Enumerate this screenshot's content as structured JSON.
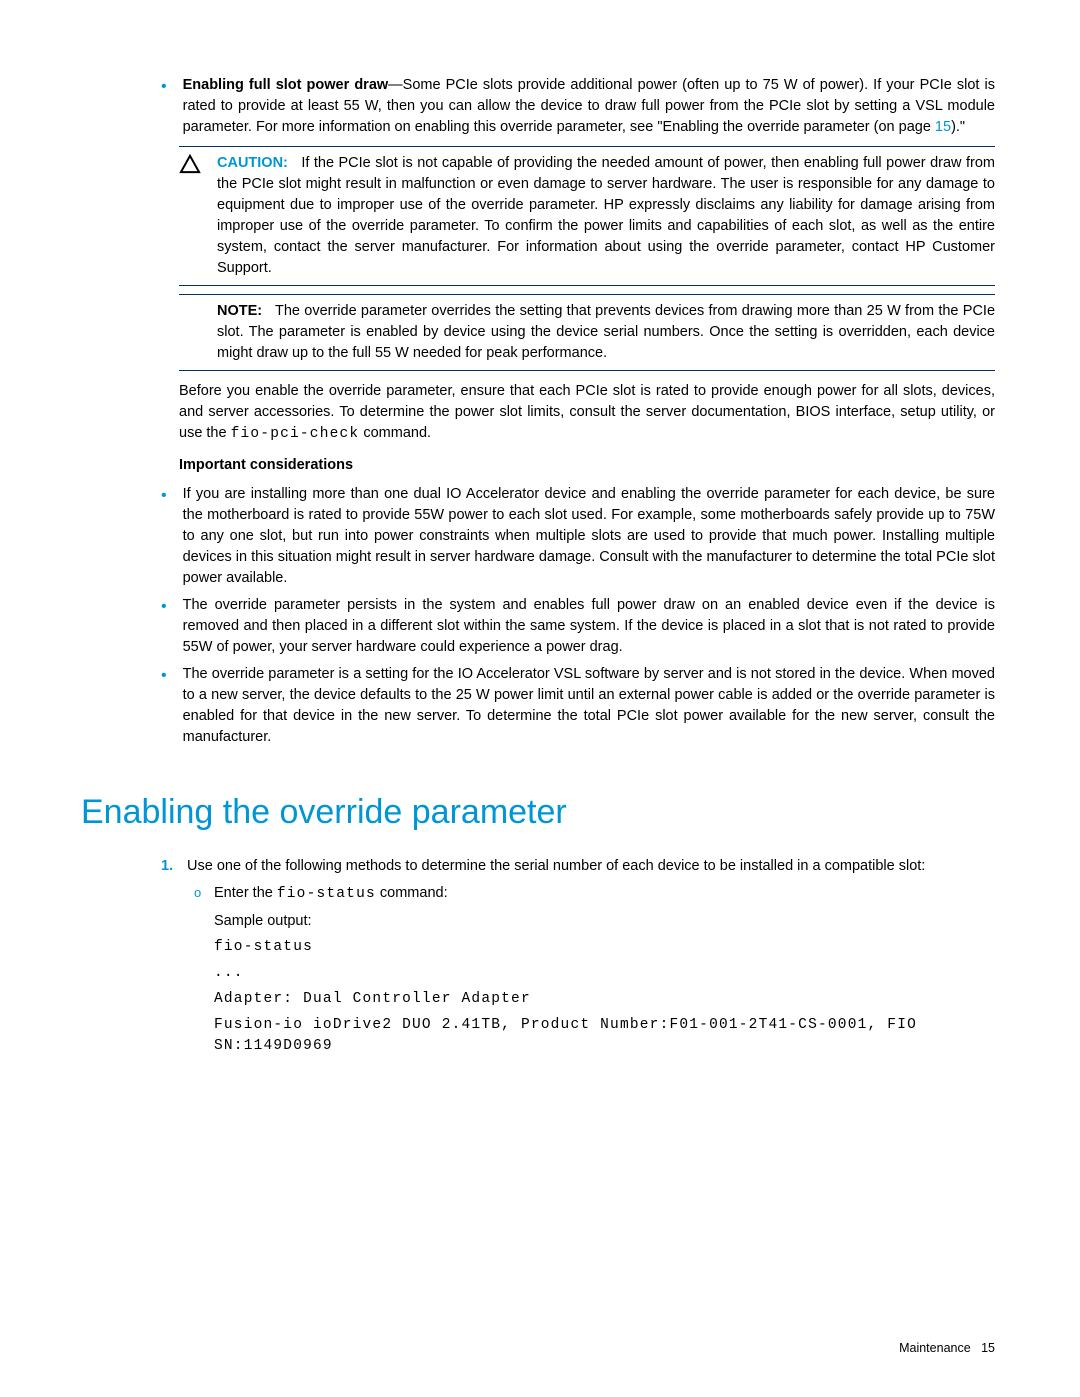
{
  "top_bullet": {
    "title": "Enabling full slot power draw",
    "text1": "—Some PCIe slots provide additional power (often up to 75 W of power). If your PCIe slot is rated to provide at least 55 W, then you can allow the device to draw full power from the PCIe slot by setting a VSL module parameter. For more information on enabling this override parameter, see \"Enabling the override parameter (on page ",
    "page": "15",
    "text2": ").\""
  },
  "caution": {
    "label": "CAUTION:",
    "text": "If the PCIe slot is not capable of providing the needed amount of power, then enabling full power draw from the PCIe slot might result in malfunction or even damage to server hardware. The user is responsible for any damage to equipment due to improper use of the override parameter. HP expressly disclaims any liability for damage arising from improper use of the override parameter. To confirm the power limits and capabilities of each slot, as well as the entire system, contact the server manufacturer. For information about using the override parameter, contact HP Customer Support."
  },
  "note": {
    "label": "NOTE:",
    "text": "The override parameter overrides the setting that prevents devices from drawing more than 25 W from the PCIe slot. The parameter is enabled by device using the device serial numbers. Once the setting is overridden, each device might draw up to the full 55 W needed for peak performance."
  },
  "before_para": {
    "text1": "Before you enable the override parameter, ensure that each PCIe slot is rated to provide enough power for all slots, devices, and server accessories. To determine the power slot limits, consult the server documentation, BIOS interface, setup utility, or use the ",
    "cmd": "fio-pci-check",
    "text2": " command."
  },
  "subhead": "Important considerations",
  "cons": [
    "If you are installing more than one dual IO Accelerator device and enabling the override parameter for each device, be sure the motherboard is rated to provide 55W power to each slot used. For example, some motherboards safely provide up to 75W to any one slot, but run into power constraints when multiple slots are used to provide that much power. Installing multiple devices in this situation might result in server hardware damage. Consult with the manufacturer to determine the total PCIe slot power available.",
    "The override parameter persists in the system and enables full power draw on an enabled device even if the device is removed and then placed in a different slot within the same system. If the device is placed in a slot that is not rated to provide 55W of power, your server hardware could experience a power drag.",
    "The override parameter is a setting for the IO Accelerator VSL software by server and is not stored in the device. When moved to a new server, the device defaults to the 25 W power limit until an external power cable is added or the override parameter is enabled for that device in the new server. To determine the total PCIe slot power available for the new server, consult the manufacturer."
  ],
  "h1": "Enabling the override parameter",
  "step1": {
    "num": "1.",
    "text": "Use one of the following methods to determine the serial number of each device to be installed in a compatible slot:"
  },
  "sub1": {
    "marker": "o",
    "text1": "Enter the ",
    "cmd": "fio-status",
    "text2": " command:"
  },
  "sample_label": "Sample output:",
  "code": {
    "l1": "fio-status",
    "l2": "...",
    "l3": "Adapter: Dual Controller Adapter",
    "l4": "Fusion-io ioDrive2 DUO 2.41TB, Product Number:F01-001-2T41-CS-0001, FIO SN:1149D0969"
  },
  "footer": {
    "section": "Maintenance",
    "page": "15"
  }
}
